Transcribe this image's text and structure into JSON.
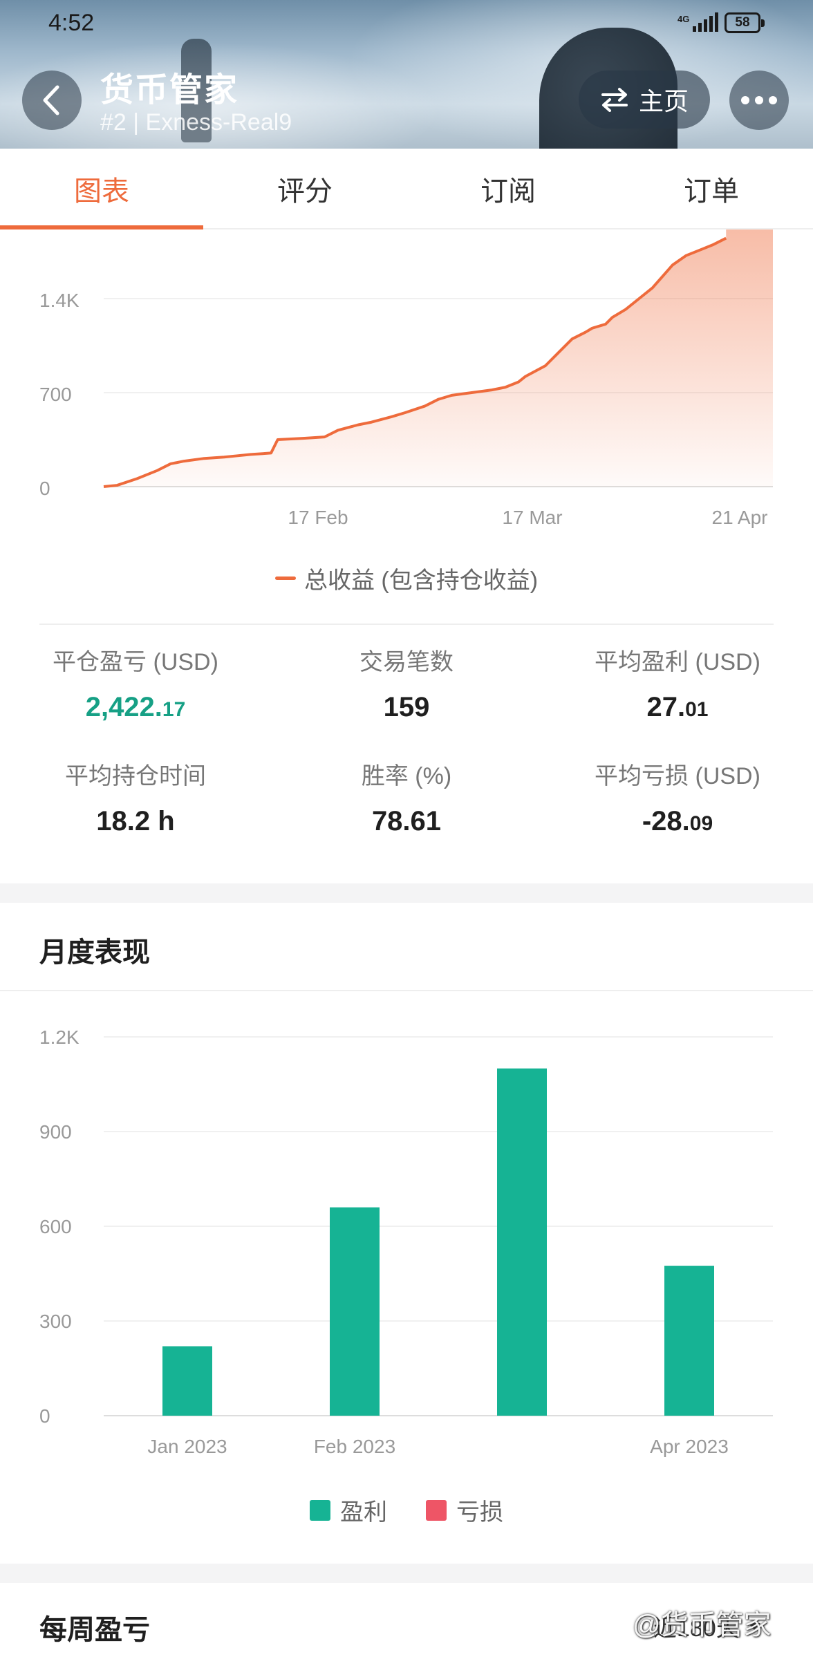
{
  "status_bar": {
    "time": "4:52",
    "network": "4G",
    "battery": "58"
  },
  "header": {
    "title": "货币管家",
    "subtitle": "#2 | Exness-Real9",
    "home_label": "主页",
    "back_icon": "chevron-left-icon",
    "more_icon": "more-dots-icon",
    "switch_icon": "swap-arrows-icon"
  },
  "tabs": [
    {
      "label": "图表",
      "active": true
    },
    {
      "label": "评分",
      "active": false
    },
    {
      "label": "订阅",
      "active": false
    },
    {
      "label": "订单",
      "active": false
    }
  ],
  "colors": {
    "accent": "#ee6b3c",
    "profit": "#16b394",
    "loss": "#ee5566",
    "green_text": "#16a085"
  },
  "stats": {
    "closed_pnl": {
      "label": "平仓盈亏 (USD)",
      "int": "2,422.",
      "dec": "17"
    },
    "trades": {
      "label": "交易笔数",
      "value": "159"
    },
    "avg_profit": {
      "label": "平均盈利 (USD)",
      "int": "27.",
      "dec": "01"
    },
    "avg_hold": {
      "label": "平均持仓时间",
      "value": "18.2 h"
    },
    "win_rate": {
      "label": "胜率 (%)",
      "value": "78.61"
    },
    "avg_loss": {
      "label": "平均亏损 (USD)",
      "int": "-28.",
      "dec": "09"
    }
  },
  "monthly": {
    "title": "月度表现",
    "legend_profit": "盈利",
    "legend_loss": "亏损"
  },
  "weekly": {
    "title": "每周盈亏",
    "range": "近180天"
  },
  "watermark": "@货币管家",
  "chart_data": [
    {
      "type": "area",
      "series": [
        {
          "name": "总收益 (包含持仓收益)"
        }
      ],
      "x_ticks": [
        "17 Feb",
        "17 Mar",
        "21 Apr"
      ],
      "y_ticks": [
        "0",
        "700",
        "1.4K"
      ],
      "ylim": [
        0,
        1850
      ],
      "x": [
        0,
        0.02,
        0.05,
        0.08,
        0.1,
        0.12,
        0.15,
        0.18,
        0.2,
        0.22,
        0.25,
        0.26,
        0.3,
        0.33,
        0.35,
        0.38,
        0.4,
        0.43,
        0.45,
        0.48,
        0.5,
        0.52,
        0.55,
        0.58,
        0.6,
        0.62,
        0.63,
        0.66,
        0.68,
        0.7,
        0.72,
        0.73,
        0.75,
        0.76,
        0.78,
        0.8,
        0.82,
        0.85,
        0.87,
        0.89,
        0.91,
        0.93
      ],
      "values": [
        0,
        10,
        60,
        120,
        170,
        190,
        210,
        220,
        230,
        240,
        250,
        350,
        360,
        370,
        420,
        460,
        480,
        520,
        550,
        600,
        650,
        680,
        700,
        720,
        740,
        780,
        820,
        900,
        1000,
        1100,
        1150,
        1180,
        1210,
        1260,
        1320,
        1400,
        1480,
        1650,
        1720,
        1760,
        1800,
        1850
      ],
      "legend": "bottom"
    },
    {
      "type": "bar",
      "categories": [
        "Jan 2023",
        "Feb 2023",
        "",
        "Apr 2023"
      ],
      "series": [
        {
          "name": "盈利",
          "values": [
            220,
            660,
            1100,
            475
          ]
        },
        {
          "name": "亏损",
          "values": [
            0,
            0,
            0,
            0
          ]
        }
      ],
      "y_ticks": [
        "0",
        "300",
        "600",
        "900",
        "1.2K"
      ],
      "ylim": [
        0,
        1200
      ],
      "legend": "bottom"
    }
  ]
}
